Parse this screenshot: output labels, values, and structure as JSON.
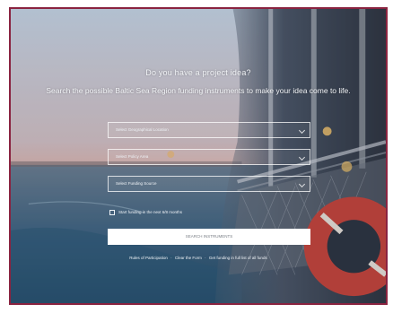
{
  "hero": {
    "headline": "Do you have a project idea?",
    "subline": "Search the possible Baltic Sea Region funding instruments to make your idea come to life."
  },
  "form": {
    "fields": [
      {
        "label": "Select Geographical Location"
      },
      {
        "label": "Select Policy Area"
      },
      {
        "label": "Select Funding Source"
      }
    ],
    "checkbox_label": "Start funding in the next 6/8 months",
    "search_button": "SEARCH INSTRUMENTS"
  },
  "footer": {
    "link_1": "Rules of Participation",
    "link_2": "Clear the Form",
    "link_3": "Get funding in full list of all funds"
  },
  "colors": {
    "frame": "#8a2340",
    "sky_top": "#c9d6e6",
    "sky_bottom": "#e8b2a4",
    "sea": "#3a5d78",
    "lifebuoy": "#c7443b"
  }
}
